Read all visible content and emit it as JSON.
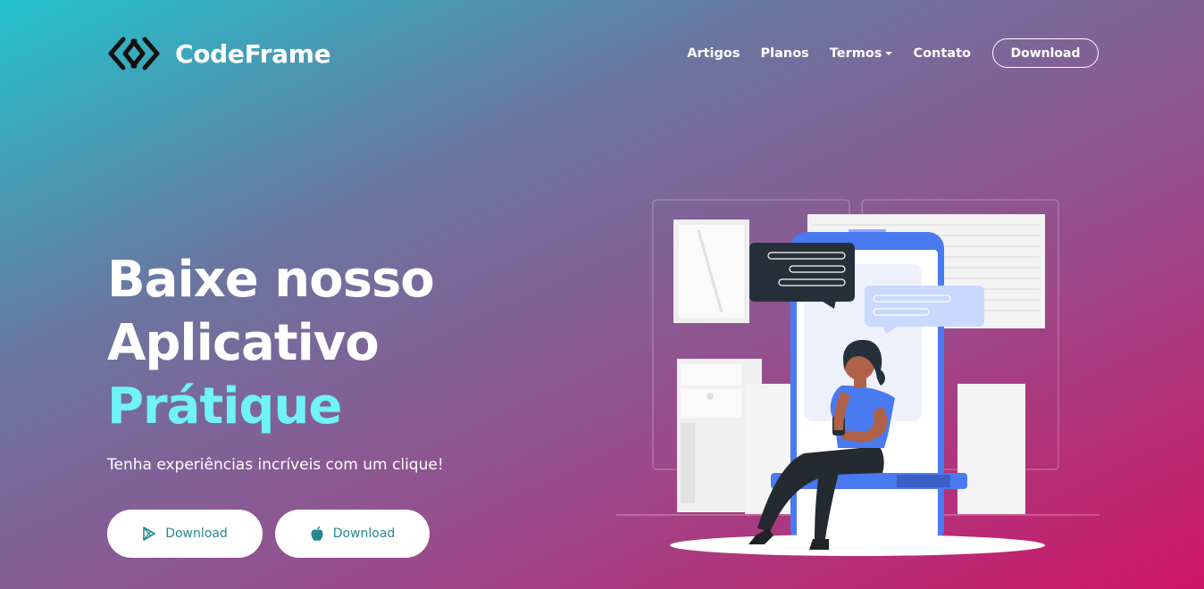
{
  "nav": {
    "brand_name": "CodeFrame",
    "links": [
      "Artigos",
      "Planos",
      "Termos",
      "Contato"
    ],
    "download_label": "Download"
  },
  "hero": {
    "title_line1": "Baixe nosso",
    "title_line2": "Aplicativo",
    "title_accent": "Prátique",
    "subtitle": "Tenha experiências incríveis com um clique!",
    "buttons": [
      {
        "label": "Download",
        "icon": "google-play-icon"
      },
      {
        "label": "Download",
        "icon": "apple-icon"
      }
    ]
  },
  "colors": {
    "gradient_start": "#22c3cc",
    "gradient_end": "#d01566",
    "accent_text": "#6ff3f6",
    "button_text": "#27888f",
    "phone_blue": "#4a7af0"
  }
}
